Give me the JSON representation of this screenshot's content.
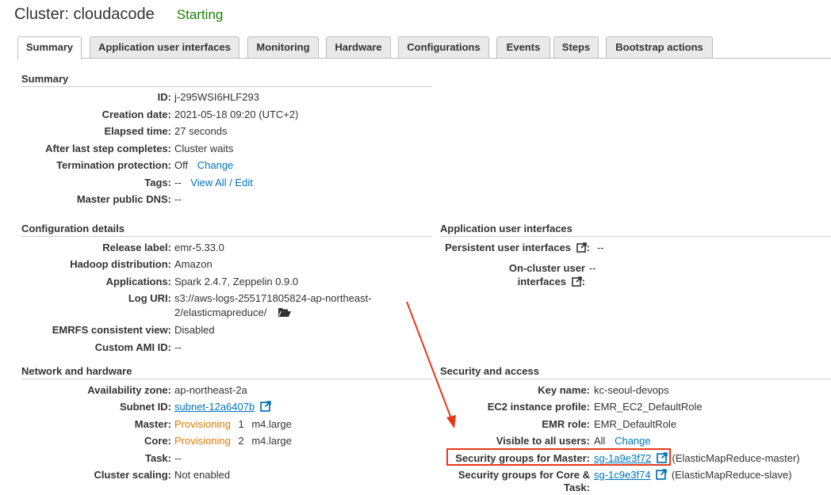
{
  "header": {
    "title": "Cluster: cloudacode",
    "status": "Starting"
  },
  "tabs": [
    {
      "label": "Summary"
    },
    {
      "label": "Application user interfaces"
    },
    {
      "label": "Monitoring"
    },
    {
      "label": "Hardware"
    },
    {
      "label": "Configurations"
    },
    {
      "label": "Events"
    },
    {
      "label": "Steps"
    },
    {
      "label": "Bootstrap actions"
    }
  ],
  "summary": {
    "title": "Summary",
    "id_label": "ID:",
    "id": "j-295WSI6HLF293",
    "creation_label": "Creation date:",
    "creation": "2021-05-18 09:20 (UTC+2)",
    "elapsed_label": "Elapsed time:",
    "elapsed": "27 seconds",
    "after_step_label": "After last step completes:",
    "after_step": "Cluster waits",
    "termination_label": "Termination protection:",
    "termination": "Off",
    "termination_link": "Change",
    "tags_label": "Tags:",
    "tags": "--",
    "tags_link": "View All / Edit",
    "dns_label": "Master public DNS:",
    "dns": "--"
  },
  "config": {
    "title": "Configuration details",
    "release_label": "Release label:",
    "release": "emr-5.33.0",
    "hadoop_label": "Hadoop distribution:",
    "hadoop": "Amazon",
    "apps_label": "Applications:",
    "apps": "Spark 2.4.7, Zeppelin 0.9.0",
    "loguri_label": "Log URI:",
    "loguri_line1": "s3://aws-logs-255171805824-ap-northeast-",
    "loguri_line2": "2/elasticmapreduce/",
    "emrfs_label": "EMRFS consistent view:",
    "emrfs": "Disabled",
    "ami_label": "Custom AMI ID:",
    "ami": "--"
  },
  "app_ui": {
    "title": "Application user interfaces",
    "persistent_label": "Persistent user interfaces",
    "persistent": "--",
    "oncluster_label_line1": "On-cluster user",
    "oncluster_label_line2": "interfaces",
    "oncluster": "--"
  },
  "network": {
    "title": "Network and hardware",
    "az_label": "Availability zone:",
    "az": "ap-northeast-2a",
    "subnet_label": "Subnet ID:",
    "subnet": "subnet-12a6407b",
    "master_label": "Master:",
    "master_status": "Provisioning",
    "master_count": "1",
    "master_type": "m4.large",
    "core_label": "Core:",
    "core_status": "Provisioning",
    "core_count": "2",
    "core_type": "m4.large",
    "task_label": "Task:",
    "task": "--",
    "scaling_label": "Cluster scaling:",
    "scaling": "Not enabled"
  },
  "security": {
    "title": "Security and access",
    "keyname_label": "Key name:",
    "keyname": "kc-seoul-devops",
    "ec2profile_label": "EC2 instance profile:",
    "ec2profile": "EMR_EC2_DefaultRole",
    "emrrole_label": "EMR role:",
    "emrrole": "EMR_DefaultRole",
    "visible_label": "Visible to all users:",
    "visible": "All",
    "visible_link": "Change",
    "sg_master_label": "Security groups for Master:",
    "sg_master": "sg-1a9e3f72",
    "sg_master_name": "(ElasticMapReduce-master)",
    "sg_core_label_line1": "Security groups for Core &",
    "sg_core_label_line2": "Task:",
    "sg_core": "sg-1c9e3f74",
    "sg_core_name": "(ElasticMapReduce-slave)"
  },
  "colors": {
    "link": "#0073bb",
    "status_green": "#1d8102",
    "provisioning": "#d97c08",
    "annotation_red": "#e8381a"
  }
}
